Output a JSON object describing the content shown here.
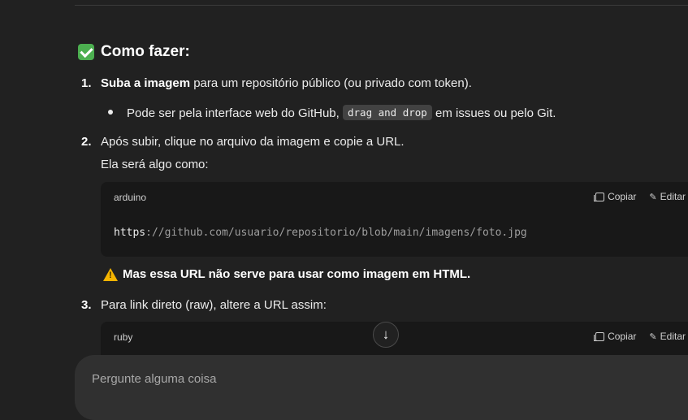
{
  "section": {
    "heading": "Como fazer:",
    "steps": [
      {
        "number": "1.",
        "bold": "Suba a imagem",
        "text": " para um repositório público (ou privado com token).",
        "bullet": {
          "before": "Pode ser pela interface web do GitHub, ",
          "code": "drag and drop",
          "after": " em issues ou pelo Git."
        }
      },
      {
        "number": "2.",
        "text": "Após subir, clique no arquivo da imagem e copie a URL.",
        "subtext": "Ela será algo como:"
      },
      {
        "number": "3.",
        "text": "Para link direto (raw), altere a URL assim:"
      }
    ],
    "codeblocks": [
      {
        "lang": "arduino",
        "copy_label": "Copiar",
        "edit_label": "Editar",
        "code_prefix": "https",
        "code_rest": "://github.com/usuario/repositorio/blob/main/imagens/foto.jpg"
      },
      {
        "lang": "ruby",
        "copy_label": "Copiar",
        "edit_label": "Editar"
      }
    ],
    "warning": "Mas essa URL não serve para usar como imagem em HTML."
  },
  "composer": {
    "placeholder": "Pergunte alguma coisa"
  },
  "icons": {
    "heading_icon": "check-mark-icon",
    "warning_icon": "warning-icon",
    "scroll_icon": "arrow-down-icon"
  }
}
